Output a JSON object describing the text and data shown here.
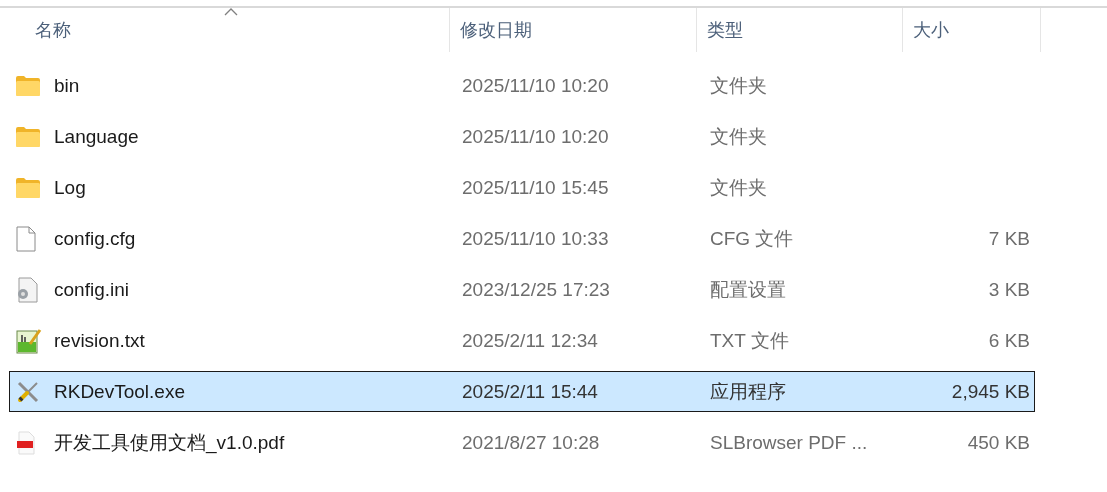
{
  "columns": [
    {
      "label": "名称",
      "sorted": true
    },
    {
      "label": "修改日期",
      "sorted": false
    },
    {
      "label": "类型",
      "sorted": false
    },
    {
      "label": "大小",
      "sorted": false
    }
  ],
  "files": [
    {
      "name": "bin",
      "date": "2025/11/10 10:20",
      "type": "文件夹",
      "kind": "folder",
      "selected": false
    },
    {
      "name": "Language",
      "date": "2025/11/10 10:20",
      "type": "文件夹",
      "kind": "folder",
      "selected": false
    },
    {
      "name": "Log",
      "date": "2025/11/10 15:45",
      "type": "文件夹",
      "kind": "folder",
      "selected": false
    },
    {
      "name": "config.cfg",
      "date": "2025/11/10 10:33",
      "type": "CFG 文件",
      "size": "7 KB",
      "kind": "file",
      "selected": false
    },
    {
      "name": "config.ini",
      "date": "2023/12/25 17:23",
      "type": "配置设置",
      "size": "3 KB",
      "kind": "settings",
      "selected": false
    },
    {
      "name": "revision.txt",
      "date": "2025/2/11 12:34",
      "type": "TXT 文件",
      "size": "6 KB",
      "kind": "text",
      "selected": false
    },
    {
      "name": "RKDevTool.exe",
      "date": "2025/2/11 15:44",
      "type": "应用程序",
      "size": "2,945 KB",
      "kind": "tool",
      "selected": true
    },
    {
      "name": "开发工具使用文档_v1.0.pdf",
      "date": "2021/8/27 10:28",
      "type": "SLBrowser PDF ...",
      "size": "450 KB",
      "kind": "pdf",
      "selected": false
    }
  ]
}
